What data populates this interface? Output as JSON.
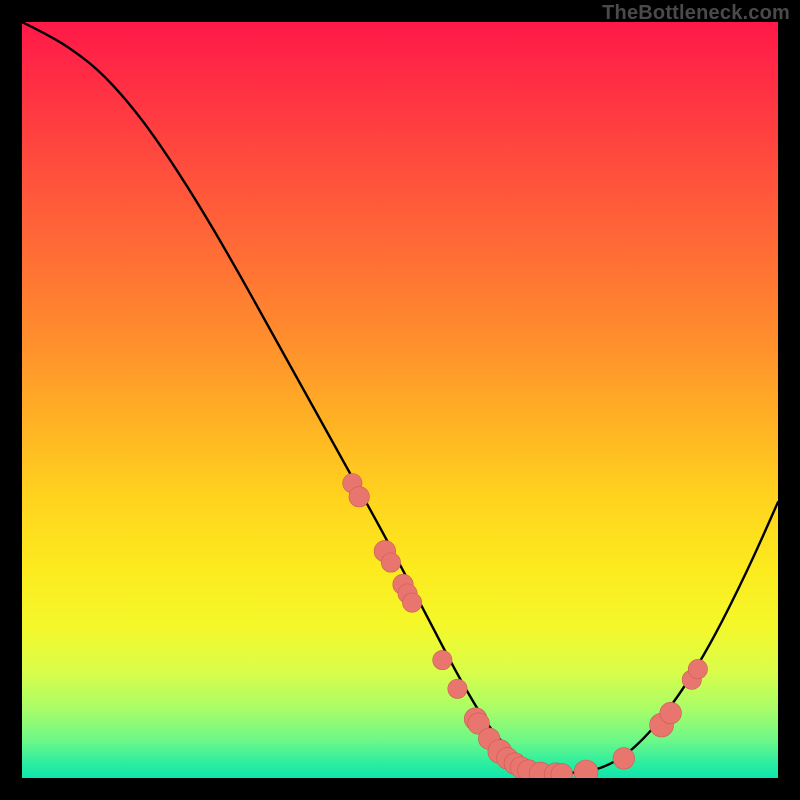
{
  "watermark": "TheBottleneck.com",
  "colors": {
    "curve": "#000000",
    "marker_fill": "#e9766e",
    "marker_stroke": "#c95b53"
  },
  "chart_data": {
    "type": "line",
    "title": "",
    "xlabel": "",
    "ylabel": "",
    "xlim": [
      0,
      100
    ],
    "ylim": [
      0,
      100
    ],
    "grid": false,
    "legend": false,
    "series": [
      {
        "name": "bottleneck-curve",
        "x": [
          0,
          3,
          6,
          10,
          14,
          18,
          23,
          28,
          33,
          38,
          43,
          48,
          53,
          57,
          60,
          62,
          64,
          66,
          68,
          70,
          73,
          77,
          81,
          86,
          91,
          96,
          100
        ],
        "y": [
          100,
          98.5,
          96.8,
          93.8,
          89.5,
          84.2,
          76.5,
          68,
          59,
          50,
          41,
          32,
          22.5,
          14.8,
          9.5,
          6.5,
          4.2,
          2.6,
          1.5,
          0.9,
          0.6,
          1.3,
          3.8,
          9.5,
          17.5,
          27.5,
          36.5
        ]
      }
    ],
    "markers": [
      {
        "x": 43.7,
        "y": 39.0,
        "r": 1.0
      },
      {
        "x": 44.6,
        "y": 37.2,
        "r": 1.1
      },
      {
        "x": 48.0,
        "y": 30.0,
        "r": 1.2
      },
      {
        "x": 48.8,
        "y": 28.5,
        "r": 1.0
      },
      {
        "x": 50.4,
        "y": 25.6,
        "r": 1.1
      },
      {
        "x": 51.0,
        "y": 24.4,
        "r": 1.0
      },
      {
        "x": 51.6,
        "y": 23.2,
        "r": 1.0
      },
      {
        "x": 55.6,
        "y": 15.6,
        "r": 1.0
      },
      {
        "x": 57.6,
        "y": 11.8,
        "r": 1.0
      },
      {
        "x": 60.0,
        "y": 7.8,
        "r": 1.3
      },
      {
        "x": 60.4,
        "y": 7.2,
        "r": 1.2
      },
      {
        "x": 61.8,
        "y": 5.2,
        "r": 1.2
      },
      {
        "x": 63.2,
        "y": 3.5,
        "r": 1.4
      },
      {
        "x": 64.2,
        "y": 2.6,
        "r": 1.2
      },
      {
        "x": 65.2,
        "y": 1.9,
        "r": 1.2
      },
      {
        "x": 66.0,
        "y": 1.4,
        "r": 1.2
      },
      {
        "x": 67.0,
        "y": 1.0,
        "r": 1.2
      },
      {
        "x": 68.6,
        "y": 0.6,
        "r": 1.3
      },
      {
        "x": 70.6,
        "y": 0.5,
        "r": 1.3
      },
      {
        "x": 71.4,
        "y": 0.5,
        "r": 1.2
      },
      {
        "x": 74.6,
        "y": 0.8,
        "r": 1.4
      },
      {
        "x": 79.6,
        "y": 2.6,
        "r": 1.2
      },
      {
        "x": 84.6,
        "y": 7.0,
        "r": 1.4
      },
      {
        "x": 85.8,
        "y": 8.6,
        "r": 1.2
      },
      {
        "x": 88.6,
        "y": 13.0,
        "r": 1.0
      },
      {
        "x": 89.4,
        "y": 14.4,
        "r": 1.0
      }
    ]
  }
}
